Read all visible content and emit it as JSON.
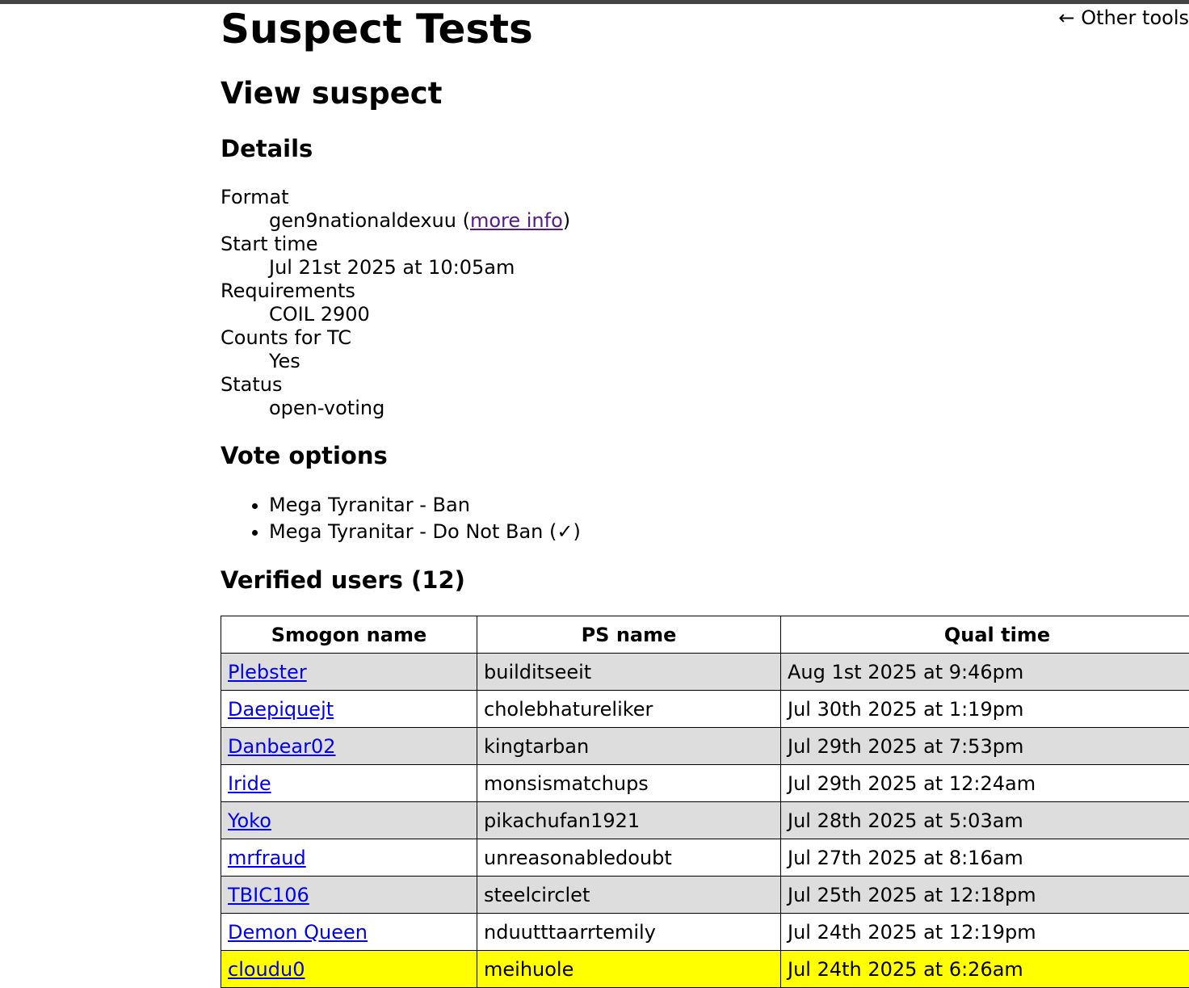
{
  "nav": {
    "back_label": "← Other tools"
  },
  "page": {
    "title": "Suspect Tests",
    "subtitle": "View suspect"
  },
  "details": {
    "heading": "Details",
    "format_label": "Format",
    "format_value": "gen9nationaldexuu",
    "format_link_label": "more info",
    "start_time_label": "Start time",
    "start_time_value": "Jul 21st 2025 at 10:05am",
    "requirements_label": "Requirements",
    "requirements_value": "COIL 2900",
    "counts_label": "Counts for TC",
    "counts_value": "Yes",
    "status_label": "Status",
    "status_value": "open-voting"
  },
  "vote_options": {
    "heading": "Vote options",
    "items": [
      "Mega Tyranitar - Ban",
      "Mega Tyranitar - Do Not Ban (✓)"
    ]
  },
  "verified": {
    "heading": "Verified users (12)",
    "columns": [
      "Smogon name",
      "PS name",
      "Qual time"
    ],
    "rows": [
      {
        "smogon": "Plebster",
        "ps": "builditseeit",
        "qual": "Aug 1st 2025 at 9:46pm"
      },
      {
        "smogon": "Daepiquejt",
        "ps": "cholebhatureliker",
        "qual": "Jul 30th 2025 at 1:19pm"
      },
      {
        "smogon": "Danbear02",
        "ps": "kingtarban",
        "qual": "Jul 29th 2025 at 7:53pm"
      },
      {
        "smogon": "Iride",
        "ps": "monsismatchups",
        "qual": "Jul 29th 2025 at 12:24am"
      },
      {
        "smogon": "Yoko",
        "ps": "pikachufan1921",
        "qual": "Jul 28th 2025 at 5:03am"
      },
      {
        "smogon": "mrfraud",
        "ps": "unreasonabledoubt",
        "qual": "Jul 27th 2025 at 8:16am"
      },
      {
        "smogon": "TBIC106",
        "ps": "steelcirclet",
        "qual": "Jul 25th 2025 at 12:18pm"
      },
      {
        "smogon": "Demon Queen",
        "ps": "nduutttaarrtemily",
        "qual": "Jul 24th 2025 at 12:19pm"
      },
      {
        "smogon": "cloudu0",
        "ps": "meihuole",
        "qual": "Jul 24th 2025 at 6:26am"
      }
    ]
  },
  "colors": {
    "highlight_row": "#ffff00",
    "alt_row": "#dddddd",
    "link": "#0000ee",
    "visited_link": "#551a8b"
  }
}
